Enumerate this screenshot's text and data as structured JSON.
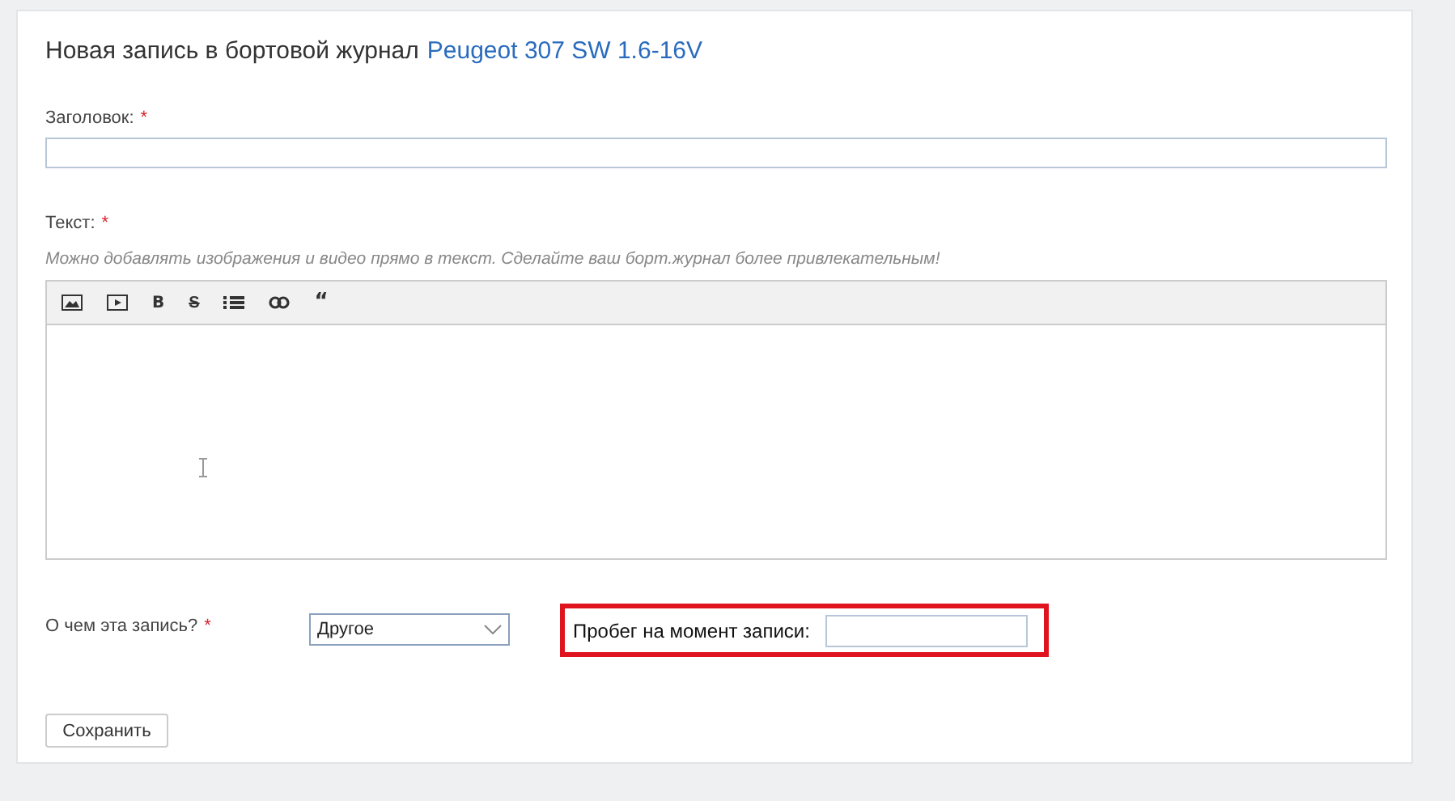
{
  "heading": {
    "text": "Новая запись в бортовой журнал",
    "car_link": "Peugeot 307 SW 1.6-16V"
  },
  "title_field": {
    "label": "Заголовок:",
    "required_mark": "*"
  },
  "text_field": {
    "label": "Текст:",
    "required_mark": "*",
    "hint": "Можно добавлять изображения и видео прямо в текст. Сделайте ваш борт.журнал более привлекательным!",
    "toolbar": [
      {
        "kind": "image"
      },
      {
        "kind": "video"
      },
      {
        "kind": "bold",
        "label": "B"
      },
      {
        "kind": "strike",
        "label": "S"
      },
      {
        "kind": "list"
      },
      {
        "kind": "link"
      },
      {
        "kind": "quote",
        "label": "“"
      }
    ]
  },
  "topic_field": {
    "label": "О чем эта запись?",
    "required_mark": "*",
    "value": "Другое"
  },
  "mileage_field": {
    "label": "Пробег на момент записи:",
    "highlighted": true
  },
  "save_button": "Сохранить"
}
